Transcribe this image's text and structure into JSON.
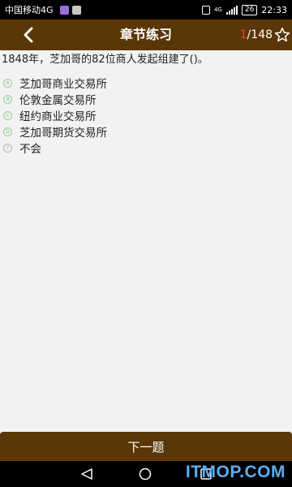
{
  "status_bar": {
    "carrier": "中国移动4G",
    "network": "4G",
    "battery": "26",
    "time": "22:33"
  },
  "header": {
    "title": "章节练习",
    "current": "1",
    "total": "/148",
    "back_icon": "chevron-left-icon",
    "star_icon": "star-outline-icon"
  },
  "question": {
    "text": "1848年，芝加哥的82位商人发起组建了()。",
    "options": [
      {
        "letter": "A",
        "label": "芝加哥商业交易所"
      },
      {
        "letter": "B",
        "label": "伦敦金属交易所"
      },
      {
        "letter": "C",
        "label": "纽约商业交易所"
      },
      {
        "letter": "D",
        "label": "芝加哥期货交易所"
      },
      {
        "letter": "?",
        "label": "不会"
      }
    ]
  },
  "footer": {
    "next_label": "下一题"
  },
  "watermark": "ITMOP.COM",
  "colors": {
    "brand_brown": "#5a3608",
    "counter_red": "#ff3b30",
    "option_green": "#8fcf8f",
    "watermark_blue": "#5fb8ff"
  }
}
